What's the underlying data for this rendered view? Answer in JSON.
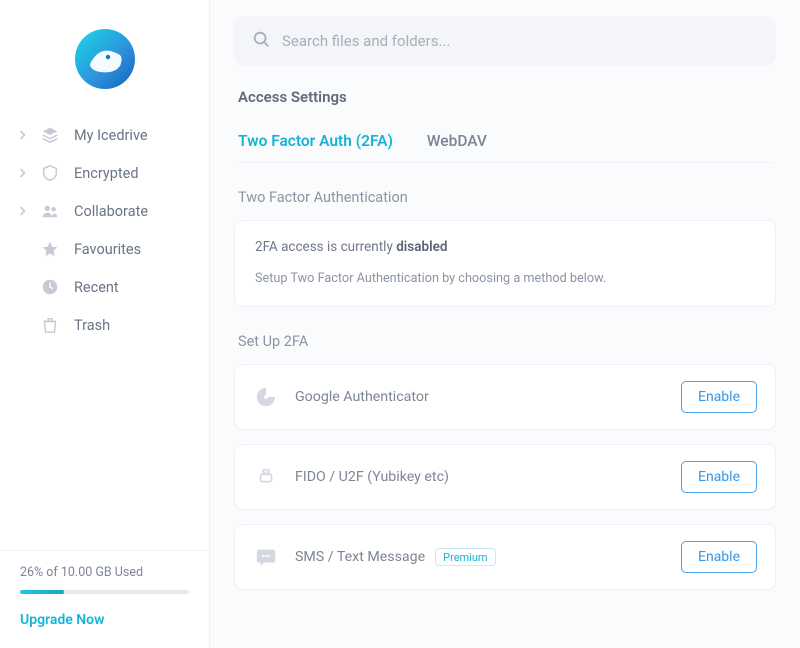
{
  "sidebar": {
    "items": [
      {
        "label": "My Icedrive"
      },
      {
        "label": "Encrypted"
      },
      {
        "label": "Collaborate"
      },
      {
        "label": "Favourites"
      },
      {
        "label": "Recent"
      },
      {
        "label": "Trash"
      }
    ],
    "storage": {
      "label": "26% of 10.00 GB Used",
      "percent": 26
    },
    "upgrade_label": "Upgrade Now"
  },
  "search": {
    "placeholder": "Search files and folders..."
  },
  "page": {
    "title": "Access Settings",
    "tabs": [
      {
        "label": "Two Factor Auth (2FA)",
        "active": true
      },
      {
        "label": "WebDAV",
        "active": false
      }
    ],
    "section_auth_label": "Two Factor Authentication",
    "status": {
      "prefix": "2FA access is currently ",
      "state": "disabled",
      "sub": "Setup Two Factor Authentication by choosing a method below."
    },
    "section_setup_label": "Set Up 2FA",
    "methods": [
      {
        "label": "Google Authenticator",
        "action": "Enable",
        "premium": false
      },
      {
        "label": "FIDO / U2F (Yubikey etc)",
        "action": "Enable",
        "premium": false
      },
      {
        "label": "SMS / Text Message",
        "action": "Enable",
        "premium": true,
        "badge": "Premium"
      }
    ]
  }
}
